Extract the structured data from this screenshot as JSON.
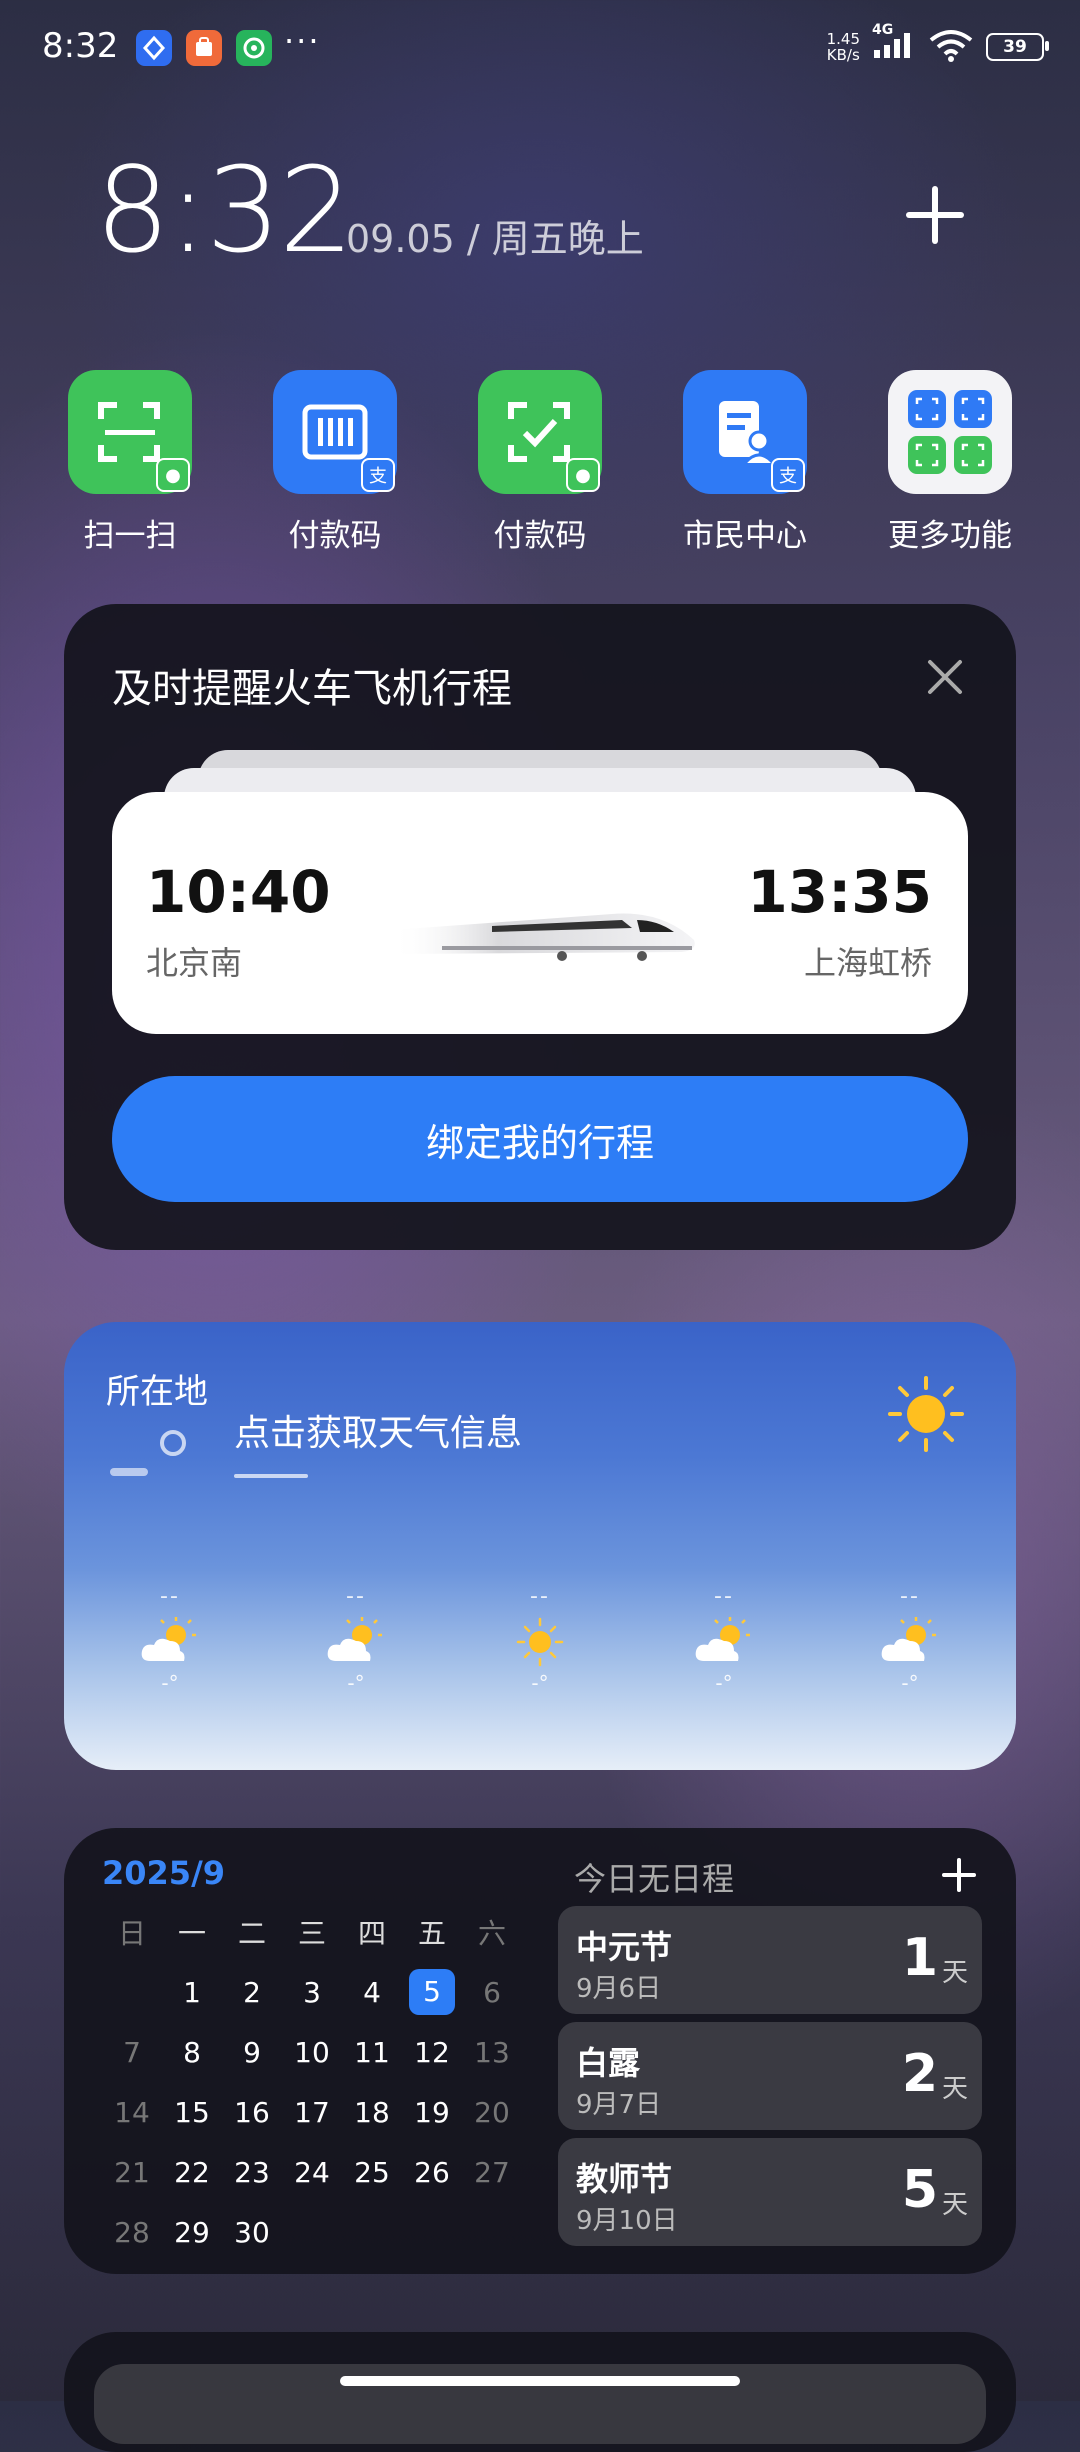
{
  "status_bar": {
    "time": "8:32",
    "dots": "···",
    "net_speed_value": "1.45",
    "net_speed_unit": "KB/s",
    "network_type": "4G",
    "battery": "39"
  },
  "clock": {
    "time": "8:32",
    "date": "09.05 / 周五晚上"
  },
  "shortcuts": [
    {
      "label": "扫一扫"
    },
    {
      "label": "付款码"
    },
    {
      "label": "付款码"
    },
    {
      "label": "市民中心"
    },
    {
      "label": "更多功能"
    }
  ],
  "trip_card": {
    "title": "及时提醒火车飞机行程",
    "depart_time": "10:40",
    "depart_station": "北京南",
    "arrive_time": "13:35",
    "arrive_station": "上海虹桥",
    "bind_button": "绑定我的行程"
  },
  "weather_card": {
    "location": "所在地",
    "prompt": "点击获取天气信息",
    "forecast": [
      {
        "top": "--",
        "bottom": "-°",
        "icon": "partly-cloudy"
      },
      {
        "top": "--",
        "bottom": "-°",
        "icon": "partly-cloudy"
      },
      {
        "top": "--",
        "bottom": "-°",
        "icon": "sunny"
      },
      {
        "top": "--",
        "bottom": "-°",
        "icon": "partly-cloudy"
      },
      {
        "top": "--",
        "bottom": "-°",
        "icon": "partly-cloudy"
      }
    ]
  },
  "calendar_card": {
    "month": "2025/9",
    "weekdays": [
      "日",
      "一",
      "二",
      "三",
      "四",
      "五",
      "六"
    ],
    "weeks": [
      [
        "",
        "1",
        "2",
        "3",
        "4",
        "5",
        "6"
      ],
      [
        "7",
        "8",
        "9",
        "10",
        "11",
        "12",
        "13"
      ],
      [
        "14",
        "15",
        "16",
        "17",
        "18",
        "19",
        "20"
      ],
      [
        "21",
        "22",
        "23",
        "24",
        "25",
        "26",
        "27"
      ],
      [
        "28",
        "29",
        "30",
        "",
        "",
        "",
        ""
      ]
    ],
    "today": "5",
    "no_event": "今日无日程",
    "holidays": [
      {
        "name": "中元节",
        "date": "9月6日",
        "days": "1",
        "unit": "天"
      },
      {
        "name": "白露",
        "date": "9月7日",
        "days": "2",
        "unit": "天"
      },
      {
        "name": "教师节",
        "date": "9月10日",
        "days": "5",
        "unit": "天"
      }
    ]
  },
  "colors": {
    "accent_blue": "#2d7df6",
    "wechat_green": "#3fc35a",
    "card_dark": "#14141c"
  }
}
